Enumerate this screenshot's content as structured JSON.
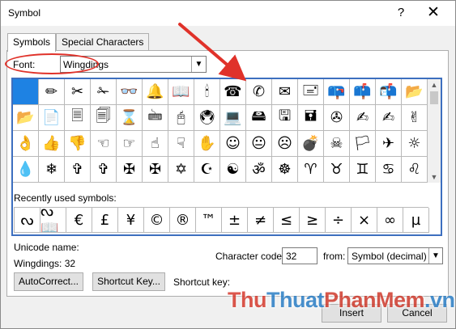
{
  "window": {
    "title": "Symbol",
    "help_glyph": "?",
    "close_glyph": "✕"
  },
  "tabs": [
    {
      "label": "Symbols",
      "active": true
    },
    {
      "label": "Special Characters",
      "active": false
    }
  ],
  "font": {
    "label": "Font:",
    "value": "Wingdings"
  },
  "symbol_grid": [
    "",
    "✏",
    "✂",
    "✁",
    "👓",
    "🔔",
    "📖",
    "🕯",
    "☎",
    "✆",
    "✉",
    "🖃",
    "📪",
    "📫",
    "📬",
    "📂",
    "📂",
    "📄",
    "🗏",
    "🗐",
    "⌛",
    "🖮",
    "🖰",
    "🖲",
    "💻",
    "🖴",
    "🖫",
    "🖬",
    "✇",
    "✍",
    "✍",
    "✌",
    "👌",
    "👍",
    "👎",
    "☜",
    "☞",
    "☝",
    "☟",
    "✋",
    "☺",
    "😐",
    "☹",
    "💣",
    "☠",
    "🏳",
    "✈",
    "☼",
    "💧",
    "❄",
    "✞",
    "✞",
    "✠",
    "✠",
    "✡",
    "☪",
    "☯",
    "ॐ",
    "☸",
    "♈",
    "♉",
    "♊",
    "♋",
    "♌"
  ],
  "recent": {
    "label": "Recently used symbols:",
    "symbols": [
      "ᔓ",
      "ᔓ📖",
      "€",
      "£",
      "¥",
      "©",
      "®",
      "™",
      "±",
      "≠",
      "≤",
      "≥",
      "÷",
      "×",
      "∞",
      "µ"
    ]
  },
  "unicode": {
    "label": "Unicode name:",
    "value": "Wingdings: 32"
  },
  "character_code": {
    "label": "Character code:",
    "value": "32"
  },
  "from": {
    "label": "from:",
    "value": "Symbol (decimal)"
  },
  "buttons": {
    "autocorrect": "AutoCorrect...",
    "shortcut_key": "Shortcut Key...",
    "insert": "Insert",
    "cancel": "Cancel"
  },
  "shortcut_label": "Shortcut key:",
  "watermark": {
    "part1": "Thu",
    "part2": "Thuat",
    "part3": "PhanMem",
    "part4": ".vn"
  },
  "colors": {
    "selection": "#1e82e3",
    "annotation": "#e0322a",
    "grid_frame": "#3d6fbf"
  }
}
